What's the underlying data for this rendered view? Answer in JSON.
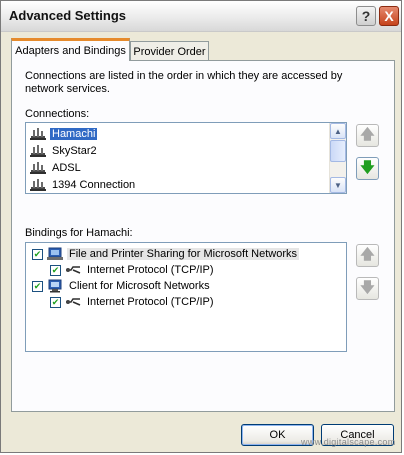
{
  "window": {
    "title": "Advanced Settings",
    "help_icon": "?",
    "close_icon": "X"
  },
  "tabs": [
    {
      "label": "Adapters and Bindings",
      "active": true
    },
    {
      "label": "Provider Order",
      "active": false
    }
  ],
  "description": "Connections are listed in the order in which they are accessed by network services.",
  "connections": {
    "label": "Connections:",
    "items": [
      {
        "label": "Hamachi",
        "selected": true,
        "icon": "network-adapter-icon"
      },
      {
        "label": "SkyStar2",
        "selected": false,
        "icon": "network-adapter-icon"
      },
      {
        "label": "ADSL",
        "selected": false,
        "icon": "network-adapter-icon"
      },
      {
        "label": "1394 Connection",
        "selected": false,
        "icon": "network-adapter-icon"
      }
    ],
    "move_up_enabled": false,
    "move_down_enabled": true
  },
  "bindings": {
    "label": "Bindings for Hamachi:",
    "items": [
      {
        "label": "File and Printer Sharing for Microsoft Networks",
        "checked": true,
        "level": 0,
        "icon": "network-service-icon"
      },
      {
        "label": "Internet Protocol (TCP/IP)",
        "checked": true,
        "level": 1,
        "icon": "protocol-icon"
      },
      {
        "label": "Client for Microsoft Networks",
        "checked": true,
        "level": 0,
        "icon": "network-client-icon"
      },
      {
        "label": "Internet Protocol (TCP/IP)",
        "checked": true,
        "level": 1,
        "icon": "protocol-icon"
      }
    ],
    "move_up_enabled": false,
    "move_down_enabled": false
  },
  "buttons": {
    "ok": "OK",
    "cancel": "Cancel"
  },
  "watermark": "www.digitalscape.com",
  "colors": {
    "selection": "#316ac5",
    "tab_accent": "#e68b2c",
    "enabled_arrow": "#1f9e1f"
  }
}
